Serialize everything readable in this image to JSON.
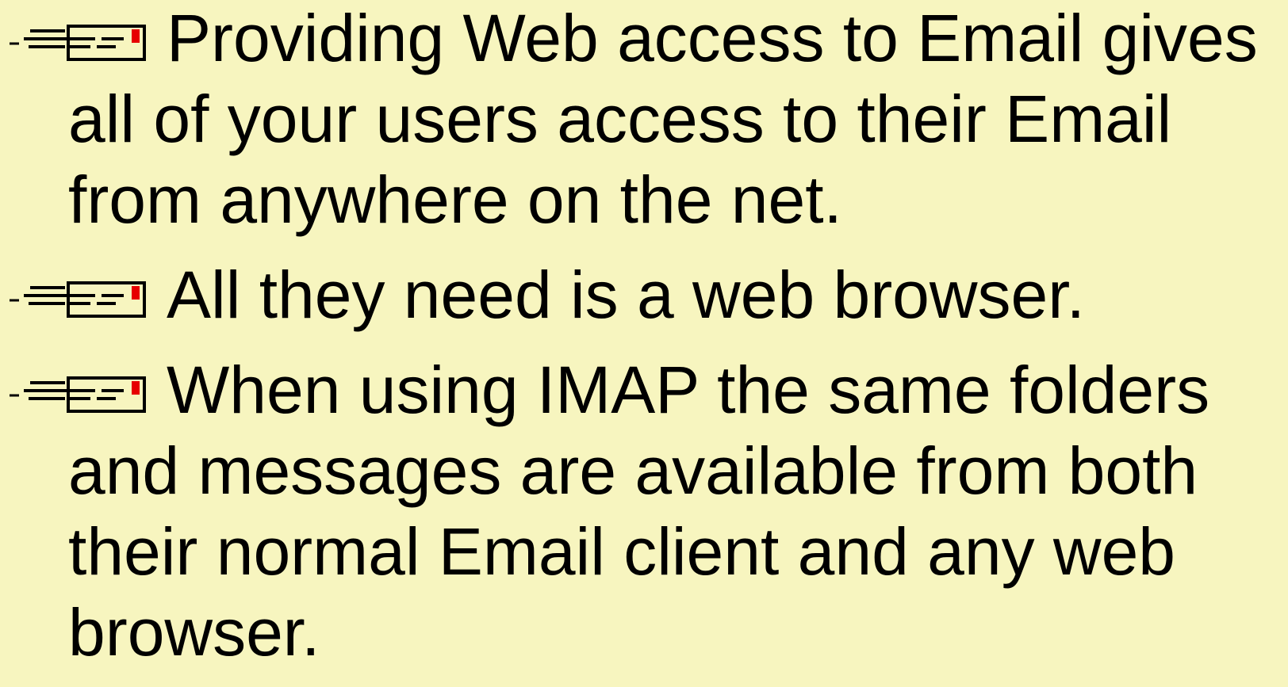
{
  "bullets": [
    {
      "icon": "email-envelope-icon",
      "text": "Providing Web access to Email gives all of your users access to their Email from anywhere on the net."
    },
    {
      "icon": "email-envelope-icon",
      "text": "All they need is a web browser."
    },
    {
      "icon": "email-envelope-icon",
      "text": "When using IMAP the same folders and messages are available from both their normal Email client and any web browser."
    }
  ],
  "colors": {
    "background": "#f7f5bf",
    "text": "#000000",
    "icon_accent": "#e60000"
  }
}
